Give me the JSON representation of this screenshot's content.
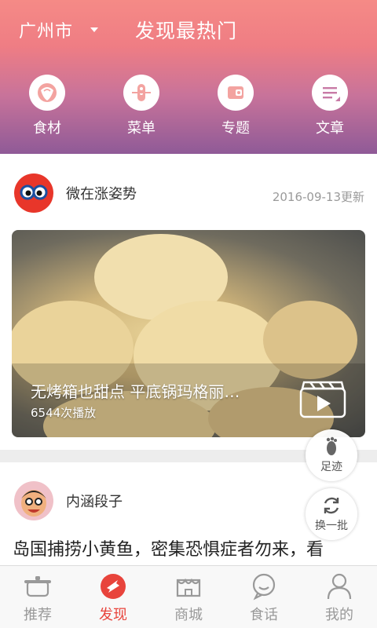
{
  "header": {
    "city": "广州市",
    "title": "发现最热门",
    "categories": [
      {
        "label": "食材",
        "icon": "ingredients-icon"
      },
      {
        "label": "菜单",
        "icon": "menu-icon"
      },
      {
        "label": "专题",
        "icon": "topic-icon"
      },
      {
        "label": "文章",
        "icon": "article-icon"
      }
    ]
  },
  "feed": {
    "card1": {
      "author": "微在涨姿势",
      "date": "2016-09-13更新",
      "video_title": "无烤箱也甜点 平底锅玛格丽…",
      "plays": "6544次播放"
    },
    "card2": {
      "author": "内涵段子",
      "headline": "岛国捕捞小黄鱼，密集恐惧症者勿来，看"
    }
  },
  "floating": {
    "footprint": "足迹",
    "refresh": "换一批"
  },
  "tabs": [
    {
      "label": "推荐",
      "icon": "pot-icon",
      "active": false
    },
    {
      "label": "发现",
      "icon": "discover-icon",
      "active": true
    },
    {
      "label": "商城",
      "icon": "shop-icon",
      "active": false
    },
    {
      "label": "食话",
      "icon": "chat-icon",
      "active": false
    },
    {
      "label": "我的",
      "icon": "profile-icon",
      "active": false
    }
  ],
  "colors": {
    "accent": "#e8443c",
    "header_top": "#f58a86",
    "header_bottom": "#8f5a97",
    "tab_inactive": "#999999"
  }
}
